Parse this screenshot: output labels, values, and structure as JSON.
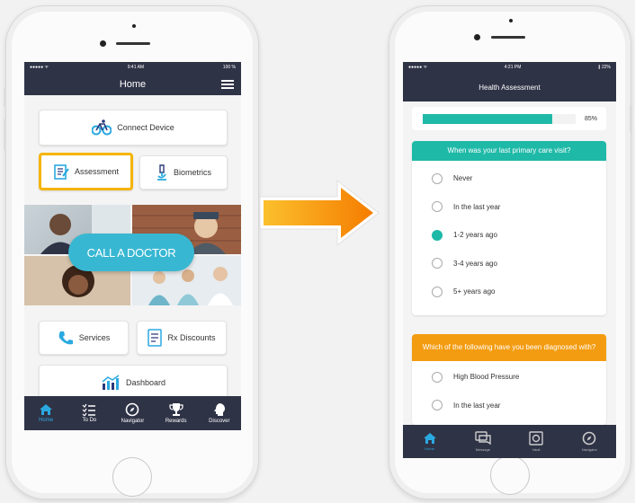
{
  "left_phone": {
    "status": {
      "carrier": "●●●●● ᯤ",
      "time": "9:41 AM",
      "battery": "100 %"
    },
    "title": "Home",
    "buttons": {
      "connect_device": "Connect Device",
      "assessment": "Assessment",
      "biometrics": "Biometrics",
      "call_doctor": "CALL A DOCTOR",
      "services": "Services",
      "rx_discounts": "Rx Discounts",
      "dashboard": "Dashboard"
    },
    "tabs": [
      "Home",
      "To Do",
      "Navigator",
      "Rewards",
      "Discover"
    ],
    "active_tab": "Home",
    "highlight_color": "#f5b400",
    "accent_color": "#2aa9e0"
  },
  "right_phone": {
    "status": {
      "carrier": "●●●●● ᯤ",
      "time": "4:21 PM",
      "battery": "∦ 22%"
    },
    "title": "Health Assessment",
    "progress": {
      "value": 0.85,
      "label": "85%"
    },
    "question1": {
      "text": "When was your last primary care visit?",
      "options": [
        "Never",
        "In the last year",
        "1-2 years ago",
        "3-4 years ago",
        "5+ years ago"
      ],
      "selected": "1-2 years ago",
      "header_color": "#1fb9a8"
    },
    "question2": {
      "text": "Which of the following have you been diagnosed with?",
      "options": [
        "High Blood Pressure",
        "In the last year"
      ],
      "header_color": "#f39c12"
    },
    "tabs": [
      "Home",
      "Message",
      "Vault",
      "Navigator"
    ],
    "active_tab": "Home"
  },
  "icons": {
    "connect_device": "bicycle-icon",
    "assessment": "clipboard-icon",
    "biometrics": "microscope-icon",
    "services": "phone-icon",
    "rx_discounts": "card-icon",
    "dashboard": "chart-icon"
  },
  "arrow_color": "#f7941d"
}
